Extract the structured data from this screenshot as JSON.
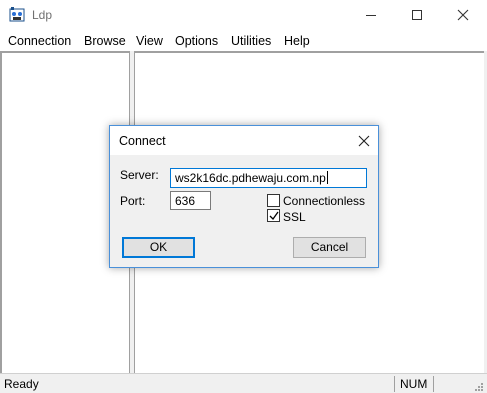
{
  "window": {
    "title": "Ldp",
    "icons": {
      "app": "ldp-app-icon",
      "minimize": "minimize-icon",
      "maximize": "maximize-icon",
      "close": "close-icon"
    }
  },
  "menu": {
    "items": [
      {
        "label": "Connection"
      },
      {
        "label": "Browse"
      },
      {
        "label": "View"
      },
      {
        "label": "Options"
      },
      {
        "label": "Utilities"
      },
      {
        "label": "Help"
      }
    ]
  },
  "status": {
    "text": "Ready",
    "num": "NUM"
  },
  "dialog": {
    "title": "Connect",
    "server_label": "Server:",
    "server_value": "ws2k16dc.pdhewaju.com.np",
    "port_label": "Port:",
    "port_value": "636",
    "connectionless_label": "Connectionless",
    "connectionless_checked": false,
    "ssl_label": "SSL",
    "ssl_checked": true,
    "ok_label": "OK",
    "cancel_label": "Cancel"
  },
  "colors": {
    "accent": "#0078d7",
    "dialog_border": "#4a90d9",
    "face": "#f0f0f0"
  }
}
